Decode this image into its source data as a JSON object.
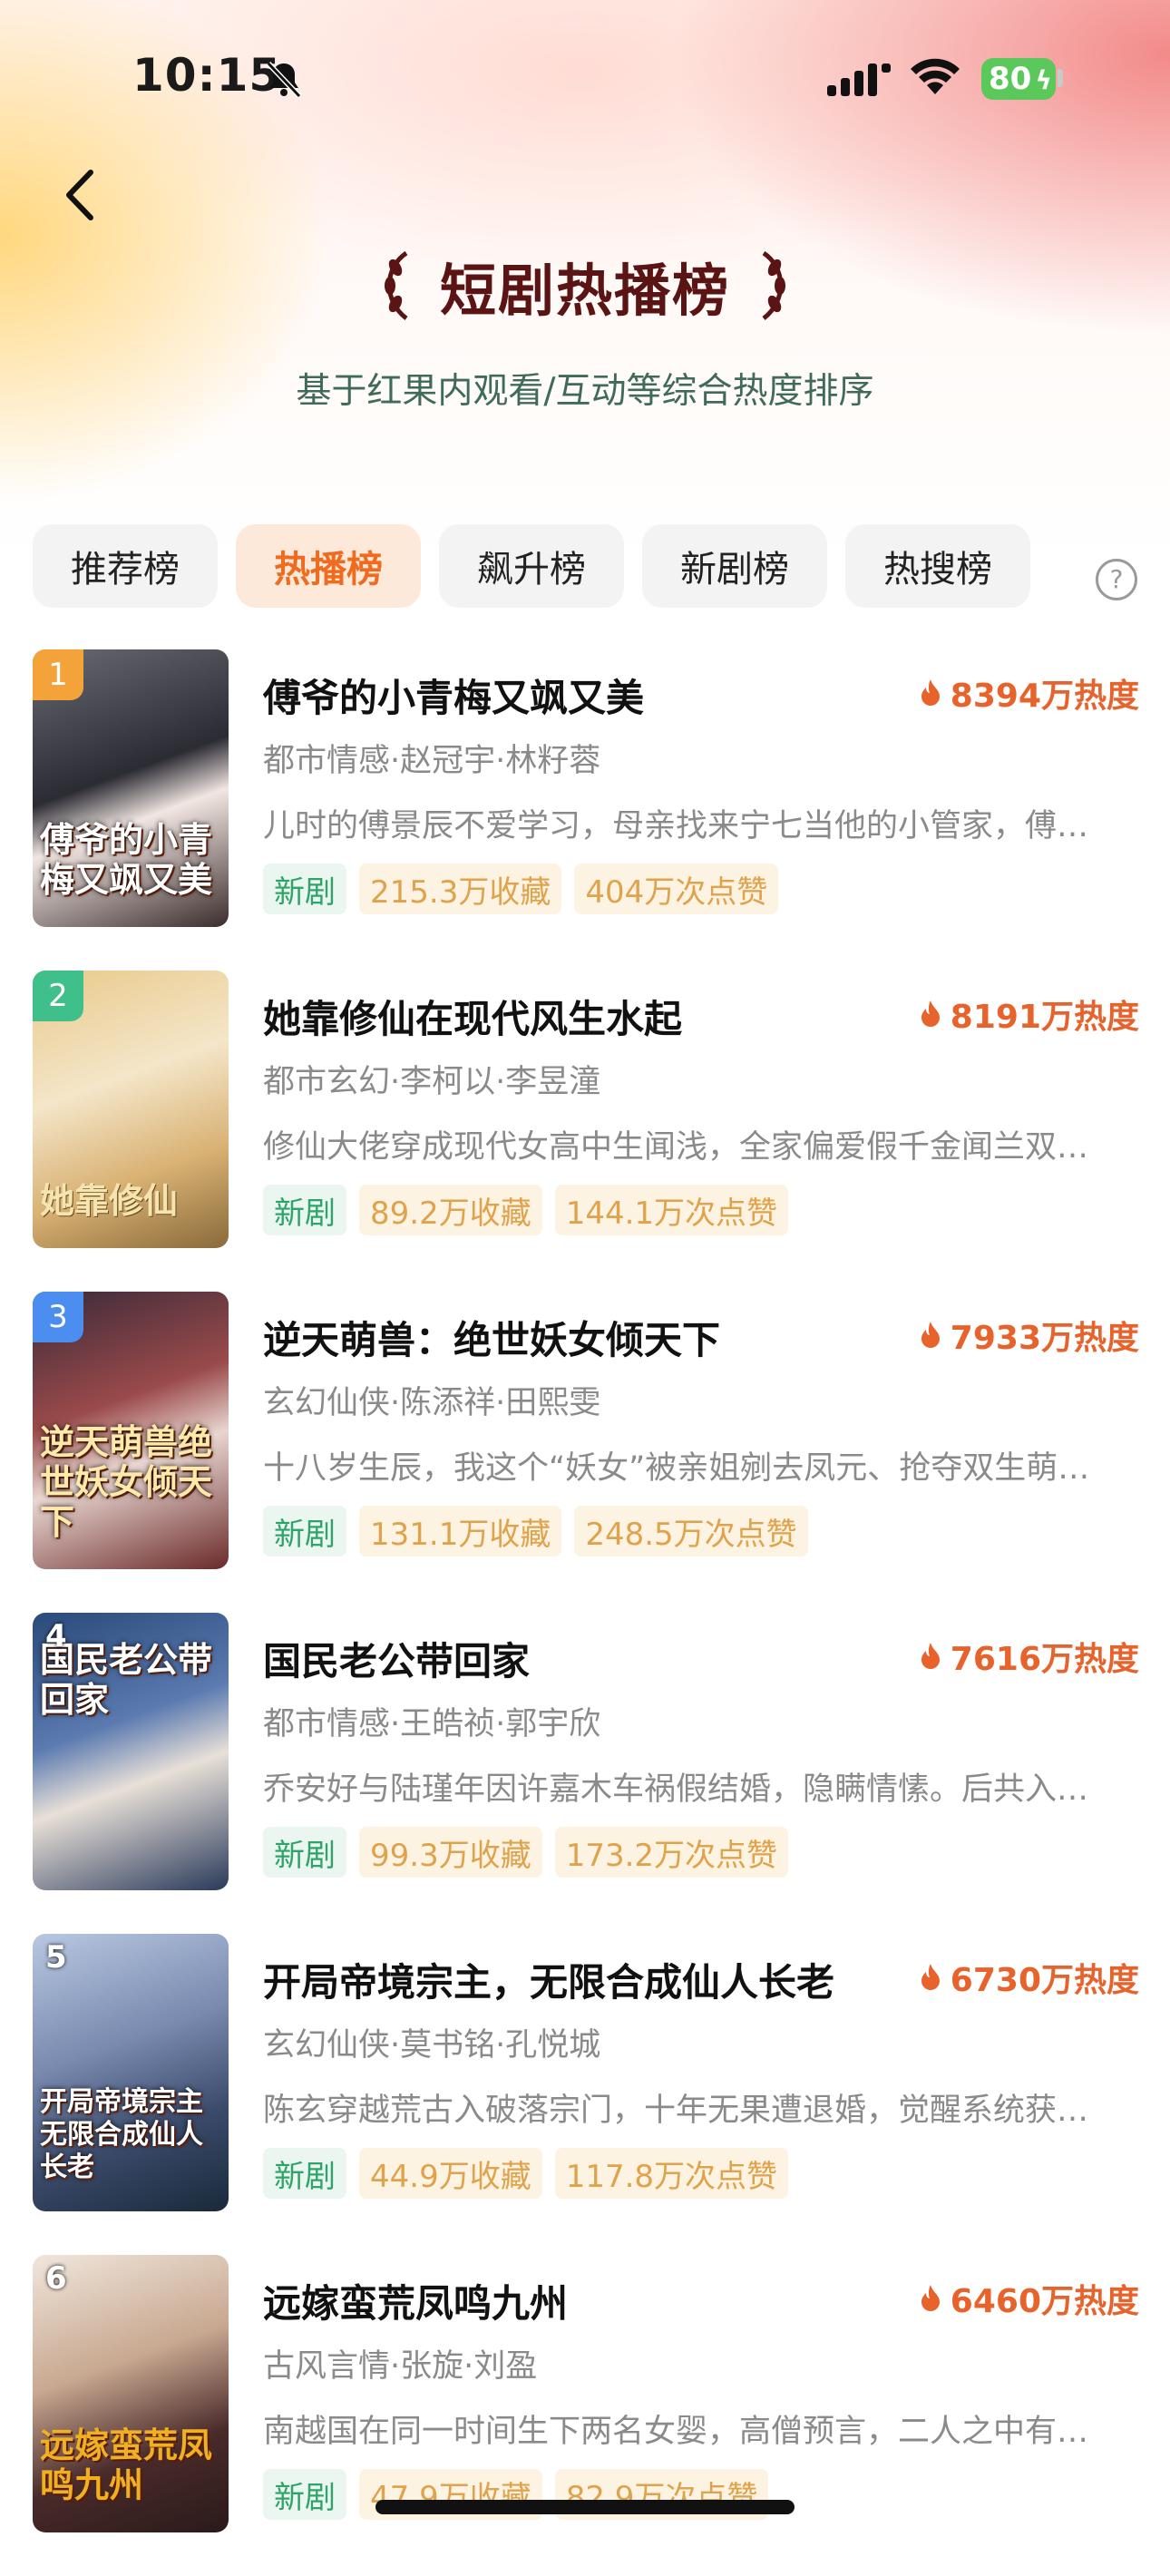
{
  "status_bar": {
    "time": "10:15",
    "battery": "80"
  },
  "header": {
    "title": "短剧热播榜",
    "subtitle": "基于红果内观看/互动等综合热度排序"
  },
  "tabs": [
    {
      "label": "推荐榜",
      "active": false
    },
    {
      "label": "热播榜",
      "active": true
    },
    {
      "label": "飙升榜",
      "active": false
    },
    {
      "label": "新剧榜",
      "active": false
    },
    {
      "label": "热搜榜",
      "active": false
    }
  ],
  "colors": {
    "accent": "#ee6b1f",
    "heat": "#e8622c",
    "new_tag": "#2ea46a",
    "stat_tag": "#e0a24a",
    "title": "#5a1414"
  },
  "items": [
    {
      "rank": "1",
      "title": "傅爷的小青梅又飒又美",
      "heat": "8394万热度",
      "meta": "都市情感·赵冠宇·林籽蓉",
      "desc": "儿时的傅景辰不爱学习，母亲找来宁七当他的小管家，傅…",
      "tag_new": "新剧",
      "favorites": "215.3万收藏",
      "likes": "404万次点赞",
      "poster_text": "傅爷的小青梅又飒又美"
    },
    {
      "rank": "2",
      "title": "她靠修仙在现代风生水起",
      "heat": "8191万热度",
      "meta": "都市玄幻·李柯以·李昱潼",
      "desc": "修仙大佬穿成现代女高中生闻浅，全家偏爱假千金闻兰双…",
      "tag_new": "新剧",
      "favorites": "89.2万收藏",
      "likes": "144.1万次点赞",
      "poster_text": "她靠修仙"
    },
    {
      "rank": "3",
      "title": "逆天萌兽：绝世妖女倾天下",
      "heat": "7933万热度",
      "meta": "玄幻仙侠·陈添祥·田熙雯",
      "desc": "十八岁生辰，我这个“妖女”被亲姐剜去凤元、抢夺双生萌…",
      "tag_new": "新剧",
      "favorites": "131.1万收藏",
      "likes": "248.5万次点赞",
      "poster_text": "逆天萌兽绝世妖女倾天下"
    },
    {
      "rank": "4",
      "title": "国民老公带回家",
      "heat": "7616万热度",
      "meta": "都市情感·王皓祯·郭宇欣",
      "desc": "乔安好与陆瑾年因许嘉木车祸假结婚，隐瞒情愫。后共入…",
      "tag_new": "新剧",
      "favorites": "99.3万收藏",
      "likes": "173.2万次点赞",
      "poster_text": "国民老公带回家"
    },
    {
      "rank": "5",
      "title": "开局帝境宗主，无限合成仙人长老",
      "heat": "6730万热度",
      "meta": "玄幻仙侠·莫书铭·孔悦城",
      "desc": "陈玄穿越荒古入破落宗门，十年无果遭退婚，觉醒系统获…",
      "tag_new": "新剧",
      "favorites": "44.9万收藏",
      "likes": "117.8万次点赞",
      "poster_text": "开局帝境宗主无限合成仙人长老"
    },
    {
      "rank": "6",
      "title": "远嫁蛮荒凤鸣九州",
      "heat": "6460万热度",
      "meta": "古风言情·张旋·刘盈",
      "desc": "南越国在同一时间生下两名女婴，高僧预言，二人之中有…",
      "tag_new": "新剧",
      "favorites": "47.9万收藏",
      "likes": "82.9万次点赞",
      "poster_text": "远嫁蛮荒凤鸣九州"
    }
  ]
}
